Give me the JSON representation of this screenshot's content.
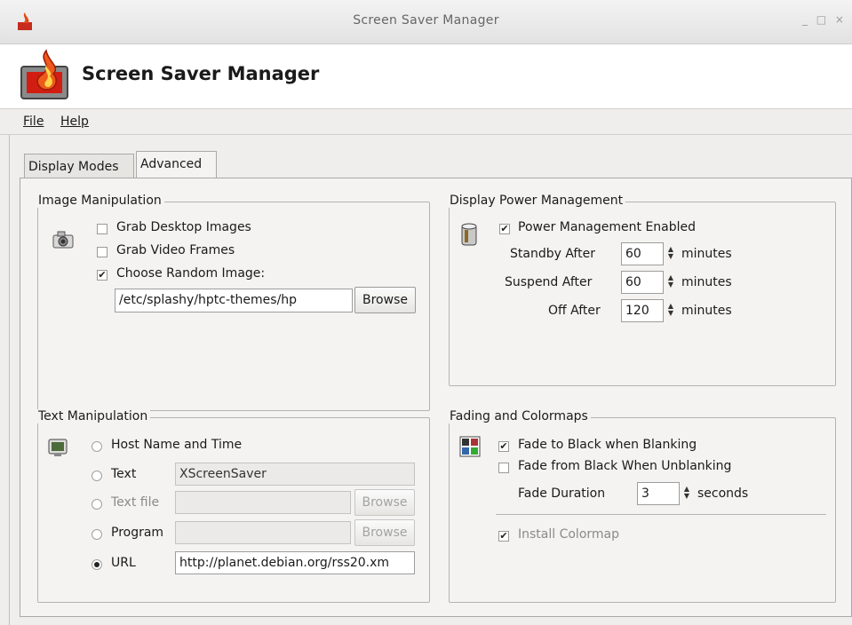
{
  "window": {
    "title": "Screen Saver Manager",
    "controls": "_ □ ×"
  },
  "header": {
    "title": "Screen Saver Manager"
  },
  "menu": {
    "file": "File",
    "help": "Help"
  },
  "tabs": {
    "display_modes": "Display Modes",
    "advanced": "Advanced"
  },
  "image_manipulation": {
    "legend": "Image Manipulation",
    "grab_desktop": "Grab Desktop Images",
    "grab_video": "Grab Video Frames",
    "choose_random": "Choose Random Image:",
    "path": "/etc/splashy/hptc-themes/hp",
    "browse": "Browse"
  },
  "power": {
    "legend": "Display Power Management",
    "enabled_label": "Power Management Enabled",
    "standby_label": "Standby After",
    "standby_value": "60",
    "suspend_label": "Suspend After",
    "suspend_value": "60",
    "off_label": "Off After",
    "off_value": "120",
    "unit": "minutes"
  },
  "text_manipulation": {
    "legend": "Text Manipulation",
    "host_name": "Host Name and Time",
    "text_label": "Text",
    "text_value": "XScreenSaver",
    "text_file_label": "Text file",
    "program_label": "Program",
    "url_label": "URL",
    "url_value": "http://planet.debian.org/rss20.xm",
    "browse": "Browse"
  },
  "fading": {
    "legend": "Fading and Colormaps",
    "fade_to_black": "Fade to Black when Blanking",
    "fade_from_black": "Fade from Black When Unblanking",
    "duration_label": "Fade Duration",
    "duration_value": "3",
    "duration_unit": "seconds",
    "install_colormap": "Install Colormap"
  }
}
